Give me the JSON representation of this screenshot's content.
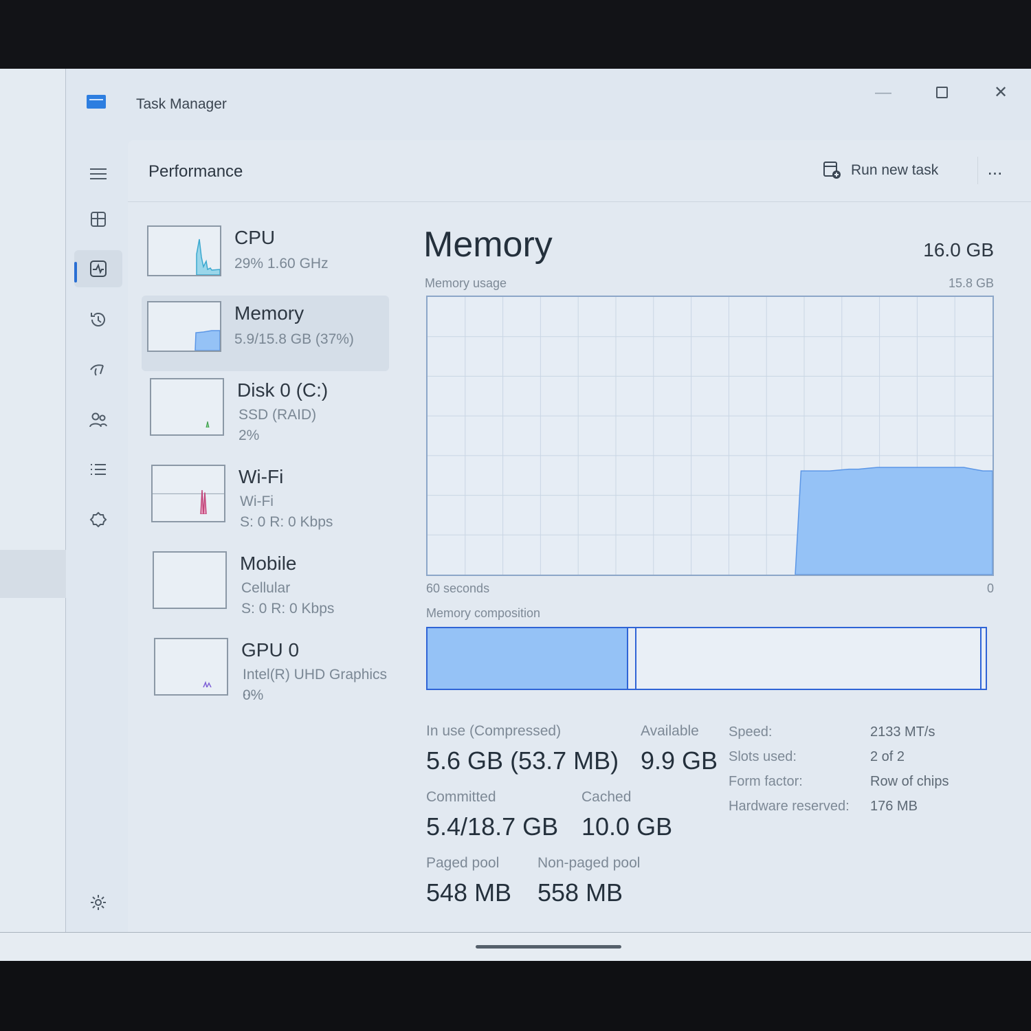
{
  "window": {
    "title": "Task Manager"
  },
  "header": {
    "title": "Performance",
    "run_new_task": "Run new task",
    "more": "..."
  },
  "nav": [
    "menu-icon",
    "processes-icon",
    "performance-icon",
    "app-history-icon",
    "startup-apps-icon",
    "users-icon",
    "details-icon",
    "services-icon",
    "settings-icon"
  ],
  "devices": [
    {
      "name": "CPU",
      "line1": "29%  1.60 GHz",
      "line2": ""
    },
    {
      "name": "Memory",
      "line1": "5.9/15.8 GB (37%)",
      "line2": ""
    },
    {
      "name": "Disk 0 (C:)",
      "line1": "SSD (RAID)",
      "line2": "2%"
    },
    {
      "name": "Wi-Fi",
      "line1": "Wi-Fi",
      "line2": "S: 0  R: 0 Kbps"
    },
    {
      "name": "Mobile",
      "line1": "Cellular",
      "line2": "S: 0  R: 0 Kbps"
    },
    {
      "name": "GPU 0",
      "line1": "Intel(R) UHD Graphics ...",
      "line2": "0%"
    }
  ],
  "memory": {
    "title": "Memory",
    "total": "16.0 GB",
    "usage_label": "Memory usage",
    "usage_max": "15.8 GB",
    "axis_left": "60 seconds",
    "axis_right": "0",
    "composition_label": "Memory composition",
    "composition": {
      "in_use_fraction": 0.36,
      "modified_fraction": 0.015
    },
    "usage_series_gb": [
      0,
      0,
      0,
      0,
      0,
      0,
      0,
      0,
      0,
      0,
      0,
      0,
      0,
      0,
      0,
      0,
      0,
      0,
      0,
      0,
      0,
      0,
      0,
      0,
      0,
      0,
      0,
      0,
      0,
      0,
      0,
      0,
      0,
      0,
      0,
      0,
      0,
      0,
      0,
      5.9,
      5.9,
      5.9,
      5.9,
      5.95,
      6.0,
      6.0,
      6.05,
      6.1,
      6.1,
      6.1,
      6.1,
      6.1,
      6.1,
      6.1,
      6.1,
      6.1,
      6.1,
      6.0,
      5.9,
      5.9
    ],
    "stats": {
      "in_use_label": "In use (Compressed)",
      "in_use": "5.6 GB (53.7 MB)",
      "available_label": "Available",
      "available": "9.9 GB",
      "committed_label": "Committed",
      "committed": "5.4/18.7 GB",
      "cached_label": "Cached",
      "cached": "10.0 GB",
      "paged_label": "Paged pool",
      "paged": "548 MB",
      "nonpaged_label": "Non-paged pool",
      "nonpaged": "558 MB"
    },
    "specs": {
      "speed_label": "Speed:",
      "speed": "2133 MT/s",
      "slots_label": "Slots used:",
      "slots": "2 of 2",
      "form_label": "Form factor:",
      "form": "Row of chips",
      "reserved_label": "Hardware reserved:",
      "reserved": "176 MB"
    }
  },
  "colors": {
    "accent": "#2a6fd3",
    "memory_fill": "#95c2f6",
    "memory_line": "#5b96e6",
    "cpu": "#45b6d8",
    "wifi": "#c2457a",
    "gpu": "#7d5fd6"
  }
}
